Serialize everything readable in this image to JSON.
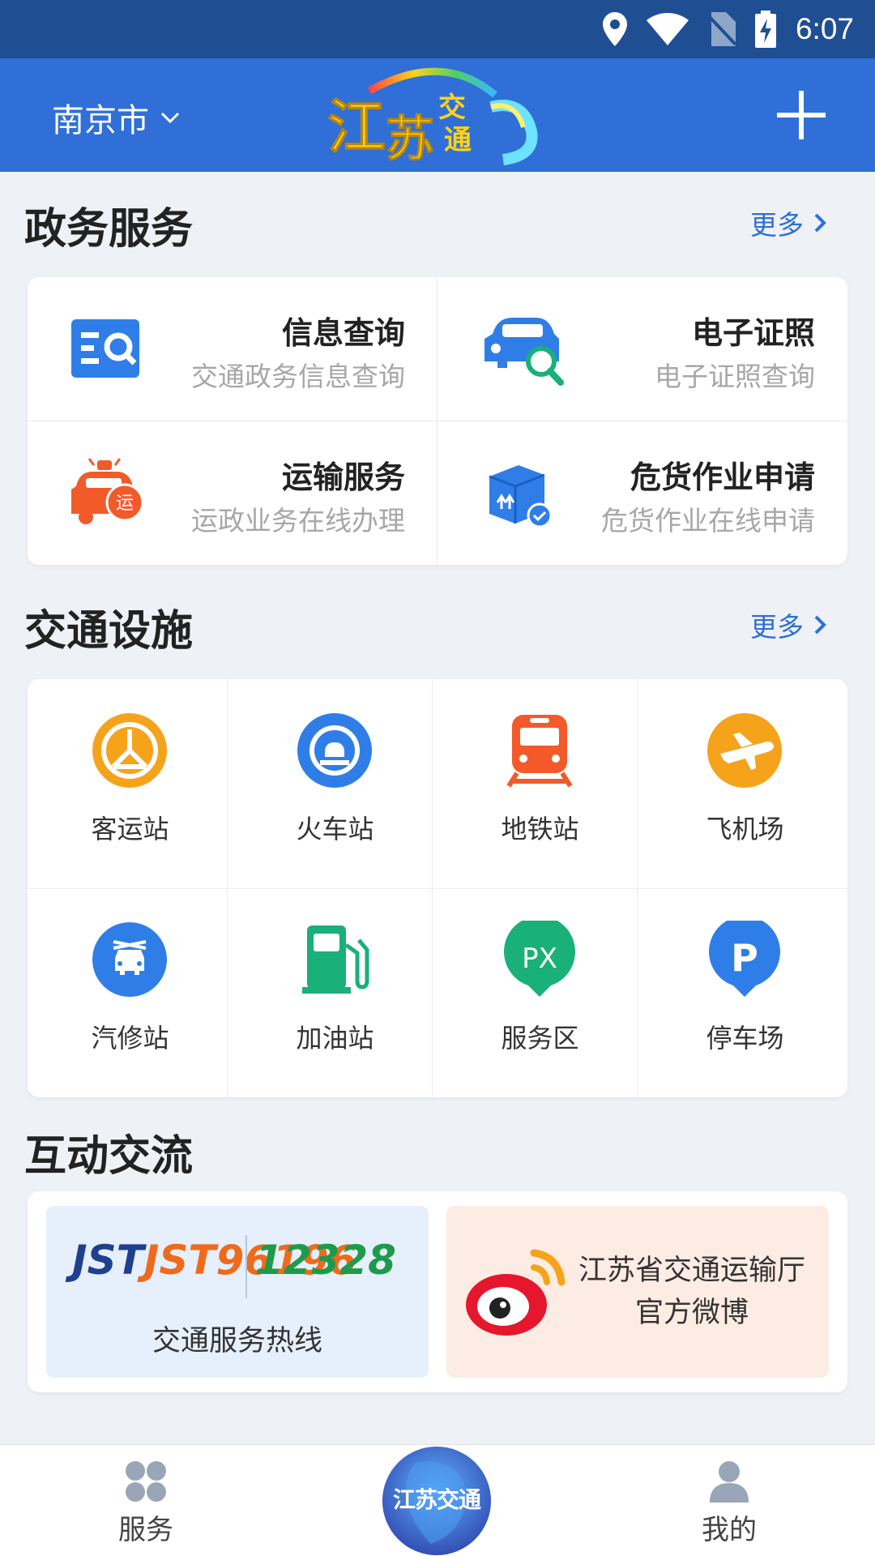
{
  "status_bar": {
    "time": "6:07"
  },
  "header": {
    "city": "南京市",
    "logo_text": "江苏交通"
  },
  "gov": {
    "title": "政务服务",
    "more": "更多",
    "items": [
      {
        "title": "信息查询",
        "subtitle": "交通政务信息查询",
        "icon": "info-search-icon"
      },
      {
        "title": "电子证照",
        "subtitle": "电子证照查询",
        "icon": "car-search-icon"
      },
      {
        "title": "运输服务",
        "subtitle": "运政业务在线办理",
        "icon": "transport-car-icon"
      },
      {
        "title": "危货作业申请",
        "subtitle": "危货作业在线申请",
        "icon": "hazmat-box-icon"
      }
    ]
  },
  "facilities": {
    "title": "交通设施",
    "more": "更多",
    "items": [
      {
        "label": "客运站",
        "icon": "bus-station-icon",
        "color": "#f6a31c"
      },
      {
        "label": "火车站",
        "icon": "train-station-icon",
        "color": "#2f7ee8"
      },
      {
        "label": "地铁站",
        "icon": "metro-icon",
        "color": "#f25a2a"
      },
      {
        "label": "飞机场",
        "icon": "airport-icon",
        "color": "#f6a31c"
      },
      {
        "label": "汽修站",
        "icon": "car-repair-icon",
        "color": "#2f7ee8"
      },
      {
        "label": "加油站",
        "icon": "gas-station-icon",
        "color": "#19b07a"
      },
      {
        "label": "服务区",
        "icon": "service-area-icon",
        "color": "#19b07a"
      },
      {
        "label": "停车场",
        "icon": "parking-icon",
        "color": "#2f7ee8"
      }
    ]
  },
  "interact": {
    "title": "互动交流",
    "hotline": {
      "logo_left": "JST96196",
      "logo_right": "12328",
      "label": "交通服务热线"
    },
    "weibo": {
      "line1": "江苏省交通运输厅",
      "line2": "官方微博"
    }
  },
  "bottom_nav": {
    "services": "服务",
    "center": "江苏交通",
    "mine": "我的"
  }
}
